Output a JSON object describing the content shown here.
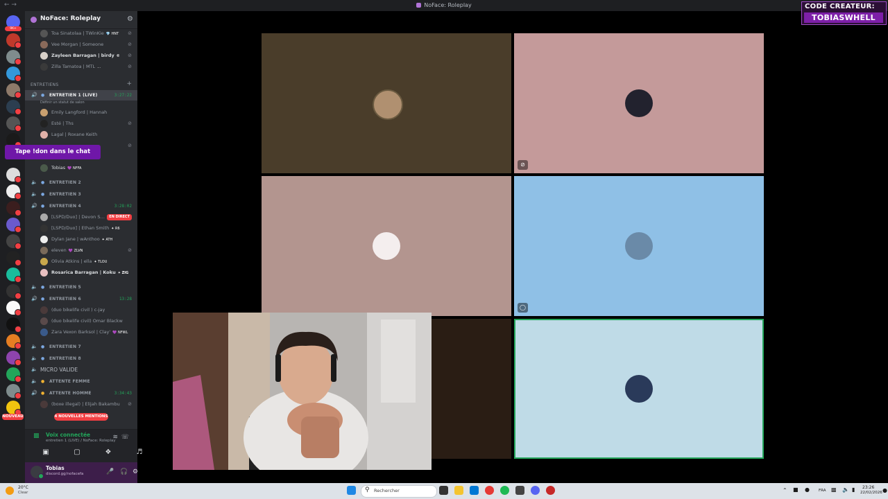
{
  "window": {
    "title": "NoFace: Roleplay",
    "nav": "← →"
  },
  "badge": {
    "line1": "CODE CREATEUR:",
    "line2": "TOBIASWHELL"
  },
  "servers": {
    "top_badge": "9K+",
    "new_label": "NOUVEAU"
  },
  "guild": {
    "name": "NoFace: Roleplay"
  },
  "sidebar": {
    "top_members": [
      {
        "name": "Toa Sinatolaa | TWinKie",
        "tag": "💎 HNT"
      },
      {
        "name": "Vee Morgan | Someone",
        "tag": ""
      },
      {
        "name": "Zayleen Barragan | birdy",
        "tag": "©"
      },
      {
        "name": "Zilla Tamatoa | MTL",
        "tag": "…"
      }
    ],
    "category": "ENTRETIENS",
    "live_channel": {
      "name": "ENTRETIEN 1 (LIVE)",
      "time": "3:27:22",
      "status": "Définir un statut de salon"
    },
    "live_members": [
      "Emily Langford | Hannah",
      "Esté | Ths",
      "Lagal | Roxane Keith"
    ],
    "banner": "Tape !don dans le chat",
    "tobias": {
      "name": "Tobias",
      "tag": "💜 NFFA"
    },
    "ch2": "ENTRETIEN 2",
    "ch3": "ENTRETIEN 3",
    "ch4": {
      "name": "ENTRETIEN 4",
      "time": "3:28:02"
    },
    "ch4_members": [
      {
        "name": "[LSPD/Duo] | Devon S…",
        "tag": "",
        "live": "EN DIRECT"
      },
      {
        "name": "[LSPD/Duo] | Ethan Smith",
        "tag": "✦ R6"
      },
      {
        "name": "Dylan Jane | wAnthoo",
        "tag": "✦ ATH"
      },
      {
        "name": "eleven",
        "tag": "💜 ZLVN"
      },
      {
        "name": "Olivia Atkins | ella",
        "tag": "✦ TLOU"
      },
      {
        "name": "Rosarica Barragan | Koku",
        "tag": "✦ ZIG"
      }
    ],
    "ch5": "ENTRETIEN 5",
    "ch6": {
      "name": "ENTRETIEN 6",
      "time": "13:28"
    },
    "ch6_members": [
      {
        "name": "(duo bikelife civil ) c-jay",
        "tag": ""
      },
      {
        "name": "(duo bikelife civil) Omar Blackw",
        "tag": ""
      },
      {
        "name": "Zara Vexon Barksol | Clay'",
        "tag": "💜 NFWL"
      }
    ],
    "ch7": "ENTRETIEN 7",
    "ch8": "ENTRETIEN 8",
    "micro": "MICRO VALIDE",
    "femme": "ATTENTE FEMME",
    "homme": {
      "name": "ATTENTE HOMME",
      "time": "3:34:43"
    },
    "homme_members": [
      "(boxe illegal) | Elijah Bakambu"
    ],
    "mentions": "4 NOUVELLES MENTIONS"
  },
  "voice": {
    "status": "Voix connectée",
    "sub": "entretien 1 (LIVE) / NoFace: Roleplay"
  },
  "user": {
    "name": "Tobias",
    "sub": "discord.gg/nofacefa"
  },
  "taskbar": {
    "temp": "20°C",
    "weather": "Clear",
    "search": "Rechercher",
    "lang": "FRA",
    "time": "23:26",
    "date": "22/02/2026"
  },
  "colors": {
    "accent": "#b073d6",
    "online": "#23a55a",
    "alert": "#f23f43",
    "banner": "#6f17a8"
  }
}
